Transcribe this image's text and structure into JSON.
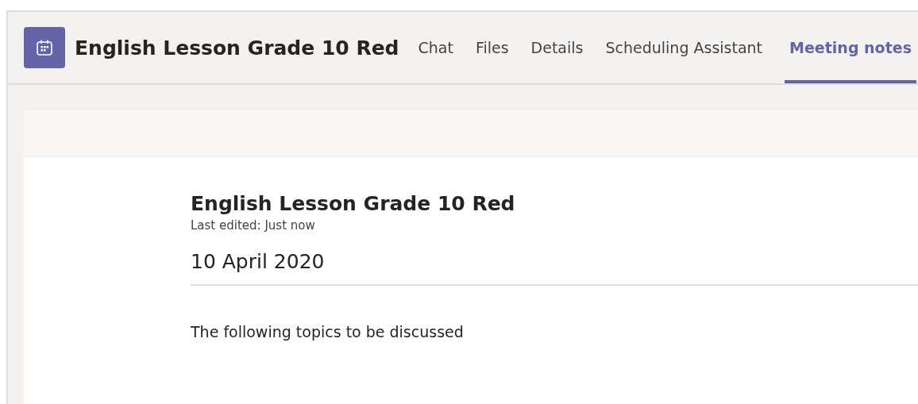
{
  "header": {
    "title": "English Lesson Grade 10 Red"
  },
  "tabs": [
    {
      "label": "Chat",
      "selected": false
    },
    {
      "label": "Files",
      "selected": false
    },
    {
      "label": "Details",
      "selected": false
    },
    {
      "label": "Scheduling Assistant",
      "selected": false
    },
    {
      "label": "Meeting notes",
      "selected": true
    }
  ],
  "notes": {
    "title": "English Lesson Grade 10 Red",
    "last_edited": "Last edited: Just now",
    "date": "10 April 2020",
    "body": "The following topics to be discussed"
  }
}
